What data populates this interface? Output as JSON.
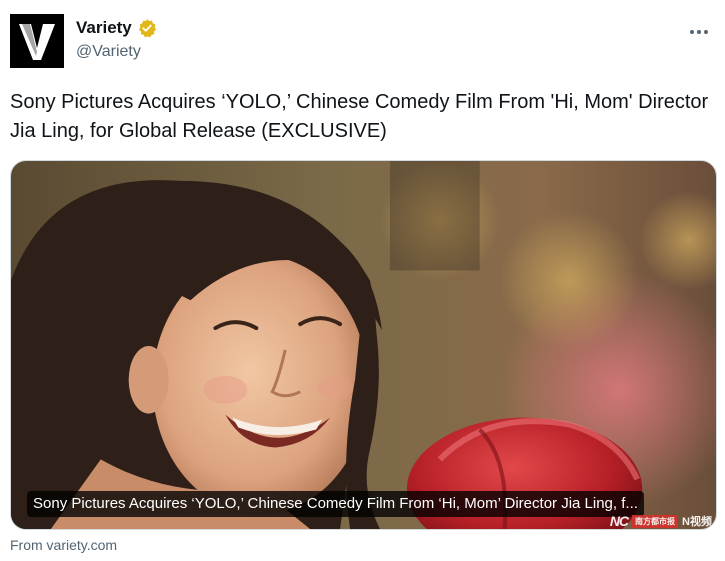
{
  "account": {
    "name": "Variety",
    "handle": "@Variety",
    "avatar_letter": "V",
    "verified_icon": "verified-badge-gold"
  },
  "more_icon": "ellipsis-icon",
  "tweet": {
    "text": "Sony Pictures Acquires ‘YOLO,’ Chinese Comedy Film From 'Hi, Mom' Director Jia Ling, for Global Release (EXCLUSIVE)"
  },
  "card": {
    "caption": "Sony Pictures Acquires ‘YOLO,’ Chinese Comedy Film From ‘Hi, Mom’ Director Jia Ling, f...",
    "watermark_logo": "NC",
    "watermark_red": "南方都市报",
    "watermark_text": "N视频",
    "image_subject": "smiling woman with red boxing glove"
  },
  "source": {
    "text": "From variety.com"
  },
  "colors": {
    "text_primary": "#0f1419",
    "text_secondary": "#536471",
    "border": "#cfd9de",
    "verified_gold": "#e2b719",
    "glove_red": "#c1272d"
  }
}
